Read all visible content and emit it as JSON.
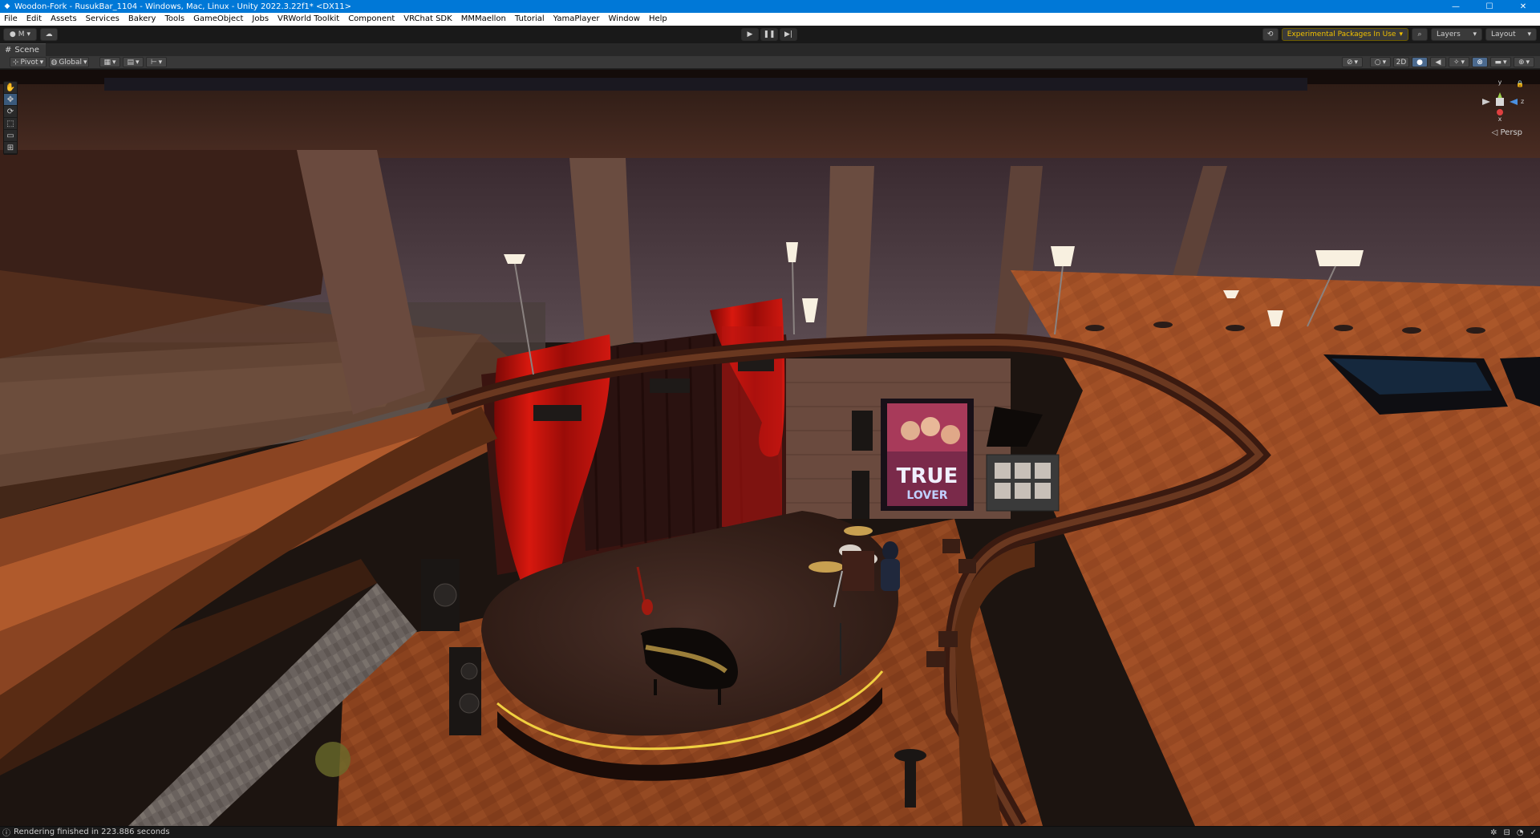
{
  "window": {
    "title": "Woodon-Fork - RusukBar_1104 - Windows, Mac, Linux - Unity 2022.3.22f1* <DX11>",
    "minimize": "—",
    "maximize": "☐",
    "close": "✕"
  },
  "menu": [
    "File",
    "Edit",
    "Assets",
    "Services",
    "Bakery",
    "Tools",
    "GameObject",
    "Jobs",
    "VRWorld Toolkit",
    "Component",
    "VRChat SDK",
    "MMMaellon",
    "Tutorial",
    "YamaPlayer",
    "Window",
    "Help"
  ],
  "toolbar": {
    "account_label": "M",
    "experimental_label": "Experimental Packages In Use",
    "layers_label": "Layers",
    "layout_label": "Layout"
  },
  "scene": {
    "tab_label": "Scene",
    "pivot_label": "Pivot",
    "global_label": "Global",
    "mode_2d": "2D",
    "persp_label": "Persp",
    "gizmo_y": "y",
    "gizmo_x": "x",
    "gizmo_z": "z"
  },
  "poster": {
    "line1": "TRUE",
    "line2": "LOVER"
  },
  "status": {
    "message": "Rendering finished in 223.886 seconds"
  },
  "colors": {
    "title_bar": "#0078d7",
    "accent_warning": "#f0c000",
    "curtain": "#c0140c",
    "wood_floor": "#9a4a22"
  }
}
